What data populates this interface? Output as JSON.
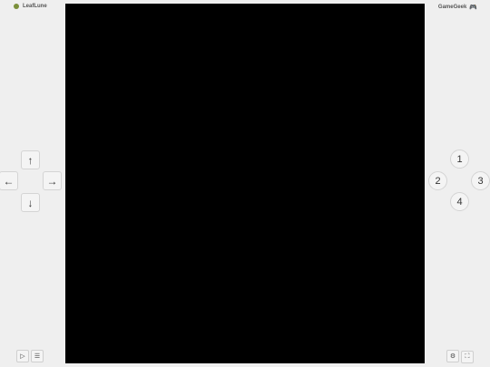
{
  "header": {
    "brand_left": "LeafLune",
    "brand_right": "GameGeek",
    "brand_right_icon": "gamepad-icon"
  },
  "dpad": {
    "up": "↑",
    "left": "←",
    "right": "→",
    "down": "↓"
  },
  "actions": {
    "b1": "1",
    "b2": "2",
    "b3": "3",
    "b4": "4"
  },
  "controls": {
    "play": "▷",
    "menu": "☰",
    "settings": "⚙",
    "fullscreen": "⛶"
  },
  "colors": {
    "background": "#efefef",
    "screen": "#000000",
    "button": "#f4f4f4"
  }
}
